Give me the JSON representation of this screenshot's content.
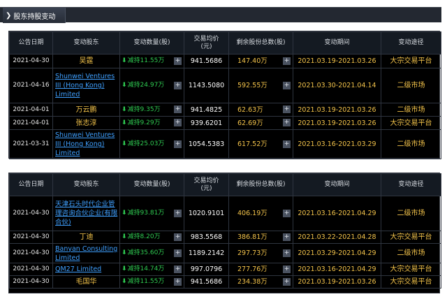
{
  "panel": {
    "title": "股东持股变动"
  },
  "columns": [
    "公告日期",
    "变动股东",
    "变动数量(股)",
    "交易均价\n(元)",
    "剩余股份总数(股)",
    "变动期间",
    "变动途径"
  ],
  "table1": {
    "rows": [
      {
        "date": "2021-04-30",
        "holder": "吴霆",
        "holder_link": false,
        "change": "减持11.55万",
        "price": "941.5686",
        "remain": "147.40万",
        "period": "2021.03.19-2021.03.26",
        "way": "大宗交易平台"
      },
      {
        "date": "2021-04-16",
        "holder": "Shunwei Ventures III (Hong Kong) Limited",
        "holder_link": true,
        "change": "减持24.97万",
        "price": "1143.5080",
        "remain": "592.55万",
        "period": "2021.03.30-2021.04.14",
        "way": "二级市场"
      },
      {
        "date": "2021-04-01",
        "holder": "万云鹏",
        "holder_link": false,
        "change": "减持9.35万",
        "price": "941.4825",
        "remain": "62.63万",
        "period": "2021.03.19-2021.03.26",
        "way": "二级市场"
      },
      {
        "date": "2021-04-01",
        "holder": "张志淳",
        "holder_link": false,
        "change": "减持9.29万",
        "price": "939.6201",
        "remain": "62.69万",
        "period": "2021.03.19-2021.03.26",
        "way": "大宗交易平台"
      },
      {
        "date": "2021-03-31",
        "holder": "Shunwei Ventures III (Hong Kong) Limited",
        "holder_link": true,
        "change": "减持25.03万",
        "price": "1054.5383",
        "remain": "617.52万",
        "period": "2021.03.16-2021.03.29",
        "way": "二级市场"
      }
    ]
  },
  "table2": {
    "rows": [
      {
        "date": "2021-04-30",
        "holder": "天津石头时代企业管理咨询合伙企业(有限合伙)",
        "holder_link": true,
        "change": "减持93.81万",
        "price": "1020.9101",
        "remain": "406.19万",
        "period": "2021.03.16-2021.04.29",
        "way": "二级市场"
      },
      {
        "date": "2021-04-30",
        "holder": "丁迪",
        "holder_link": false,
        "change": "减持8.20万",
        "price": "983.5568",
        "remain": "386.81万",
        "period": "2021.03.22-2021.04.28",
        "way": "大宗交易平台"
      },
      {
        "date": "2021-04-30",
        "holder": "Banyan Consulting Limited",
        "holder_link": true,
        "change": "减持35.60万",
        "price": "1189.2142",
        "remain": "297.73万",
        "period": "2021.03.29-2021.04.29",
        "way": "二级市场"
      },
      {
        "date": "2021-04-30",
        "holder": "QM27 Limited",
        "holder_link": true,
        "change": "减持14.74万",
        "price": "997.0796",
        "remain": "277.76万",
        "period": "2021.03.16-2021.04.29",
        "way": "大宗交易平台"
      },
      {
        "date": "2021-04-30",
        "holder": "毛国华",
        "holder_link": false,
        "change": "减持11.55万",
        "price": "941.5686",
        "remain": "234.38万",
        "period": "2021.03.19-2021.03.26",
        "way": "大宗交易平台"
      }
    ]
  },
  "icons": {
    "tab_arrow": "chevron-right-icon",
    "decrease": "down-arrow-icon",
    "expand": "plus-icon"
  },
  "colors": {
    "header_bg": "#141a22",
    "body_bg": "#000000",
    "yellow": "#f3c34a",
    "green": "#2fcc52",
    "link": "#3fa0ff"
  }
}
